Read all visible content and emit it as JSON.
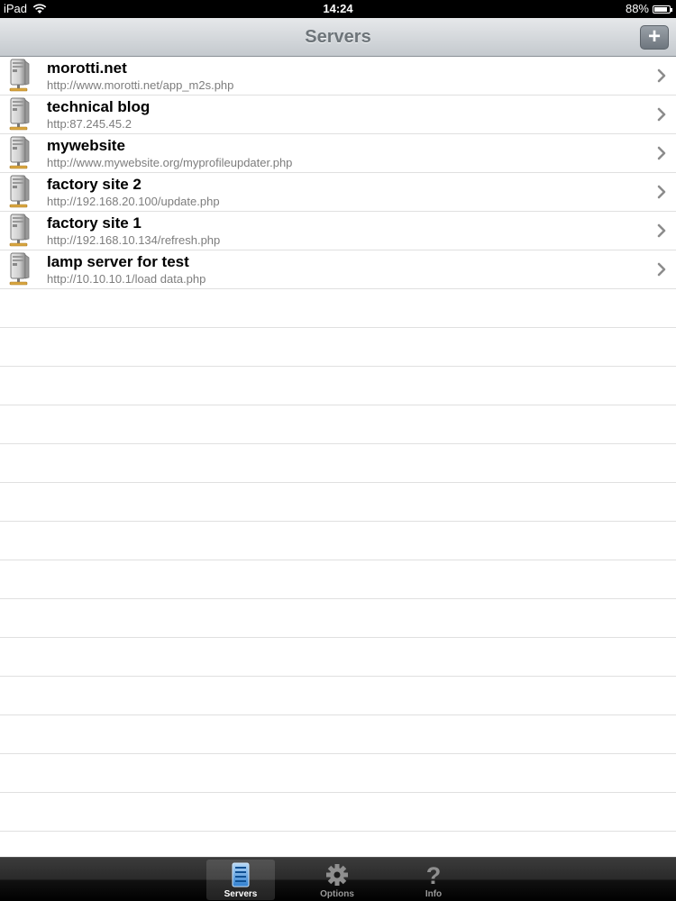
{
  "status_bar": {
    "carrier": "iPad",
    "time": "14:24",
    "battery": "88%",
    "battery_level": 0.88
  },
  "nav": {
    "title": "Servers",
    "add_label": "+"
  },
  "servers": [
    {
      "name": "morotti.net",
      "url": "http://www.morotti.net/app_m2s.php"
    },
    {
      "name": "technical blog",
      "url": "http:87.245.45.2"
    },
    {
      "name": "mywebsite",
      "url": "http://www.mywebsite.org/myprofileupdater.php"
    },
    {
      "name": "factory site 2",
      "url": "http://192.168.20.100/update.php"
    },
    {
      "name": "factory site 1",
      "url": "http://192.168.10.134/refresh.php"
    },
    {
      "name": "lamp server for test",
      "url": "http://10.10.10.1/load data.php"
    }
  ],
  "tabs": [
    {
      "label": "Servers",
      "icon": "server-icon",
      "selected": true
    },
    {
      "label": "Options",
      "icon": "gear-icon",
      "selected": false
    },
    {
      "label": "Info",
      "icon": "question-icon",
      "selected": false
    }
  ],
  "colors": {
    "accent_chevron": "#8c8c8c",
    "subtitle": "#7d7d7d"
  }
}
